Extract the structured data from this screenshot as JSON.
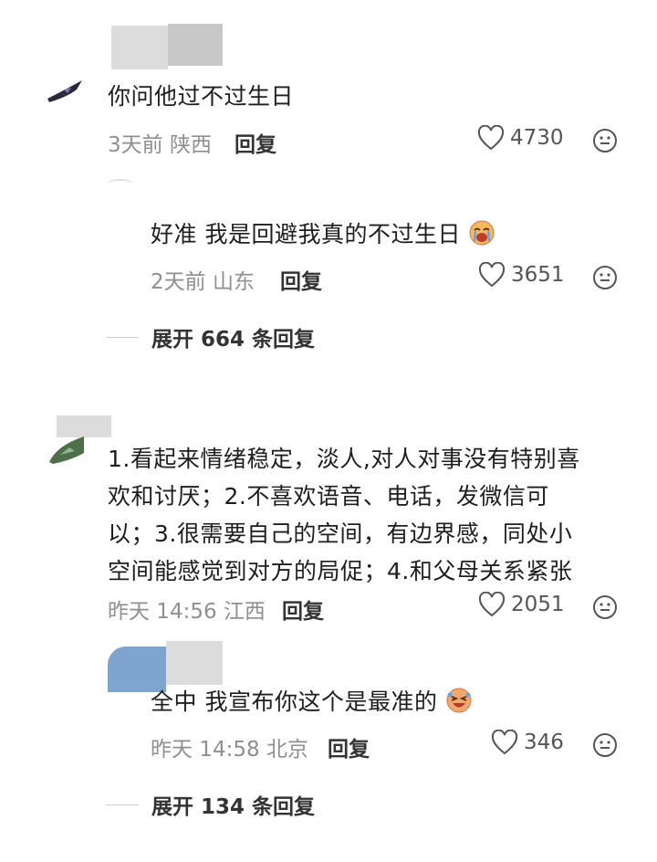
{
  "comments": [
    {
      "text": "你问他过不过生日",
      "time": "3天前",
      "location": "陕西",
      "reply_label": "回复",
      "likes": "4730",
      "replies": [
        {
          "text": "好准 我是回避我真的不过生日",
          "time": "2天前",
          "location": "山东",
          "reply_label": "回复",
          "likes": "3651"
        }
      ],
      "expand": "展开 664 条回复"
    },
    {
      "text_lines": [
        "1.看起来情绪稳定，淡人,对人对事没有特别喜",
        "欢和讨厌；2.不喜欢语音、电话，发微信可",
        "以；3.很需要自己的空间，有边界感，同处小",
        "空间能感觉到对方的局促；4.和父母关系紧张"
      ],
      "time": "昨天 14:56",
      "location": "江西",
      "reply_label": "回复",
      "likes": "2051",
      "replies": [
        {
          "text": "全中 我宣布你这个是最准的",
          "time": "昨天 14:58",
          "location": "北京",
          "reply_label": "回复",
          "likes": "346"
        }
      ],
      "expand": "展开 134 条回复"
    }
  ],
  "icons": {
    "like": "heart-outline-icon",
    "emoji": "smiley-face-icon",
    "crying": "crying-face-emoji",
    "laughing": "laughing-tears-emoji"
  },
  "colors": {
    "text": "#1e1e1e",
    "meta": "#8f8f8f",
    "reply": "#333333"
  }
}
